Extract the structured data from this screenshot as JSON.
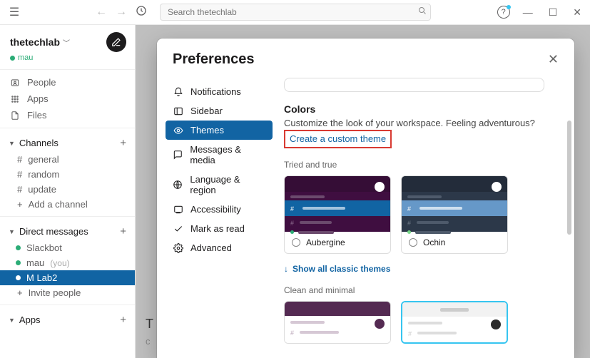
{
  "search": {
    "placeholder": "Search thetechlab"
  },
  "workspace": {
    "name": "thetechlab",
    "user": "mau"
  },
  "sidebar": {
    "nav": [
      {
        "label": "People"
      },
      {
        "label": "Apps"
      },
      {
        "label": "Files"
      }
    ],
    "channels_header": "Channels",
    "channels": [
      {
        "name": "general"
      },
      {
        "name": "random"
      },
      {
        "name": "update"
      }
    ],
    "add_channel": "Add a channel",
    "dm_header": "Direct messages",
    "dms": [
      {
        "name": "Slackbot",
        "you": ""
      },
      {
        "name": "mau",
        "you": "(you)"
      },
      {
        "name": "M Lab2",
        "you": ""
      }
    ],
    "invite": "Invite people",
    "apps_header": "Apps"
  },
  "behind": {
    "line1": "T",
    "line2": "c"
  },
  "modal": {
    "title": "Preferences",
    "nav": [
      "Notifications",
      "Sidebar",
      "Themes",
      "Messages & media",
      "Language & region",
      "Accessibility",
      "Mark as read",
      "Advanced"
    ],
    "colors": {
      "title": "Colors",
      "desc": "Customize the look of your workspace. Feeling adventurous?",
      "link": "Create a custom theme"
    },
    "tried_true": "Tried and true",
    "themes": [
      {
        "name": "Aubergine"
      },
      {
        "name": "Ochin"
      }
    ],
    "show_all": "Show all classic themes",
    "clean_minimal": "Clean and minimal"
  }
}
